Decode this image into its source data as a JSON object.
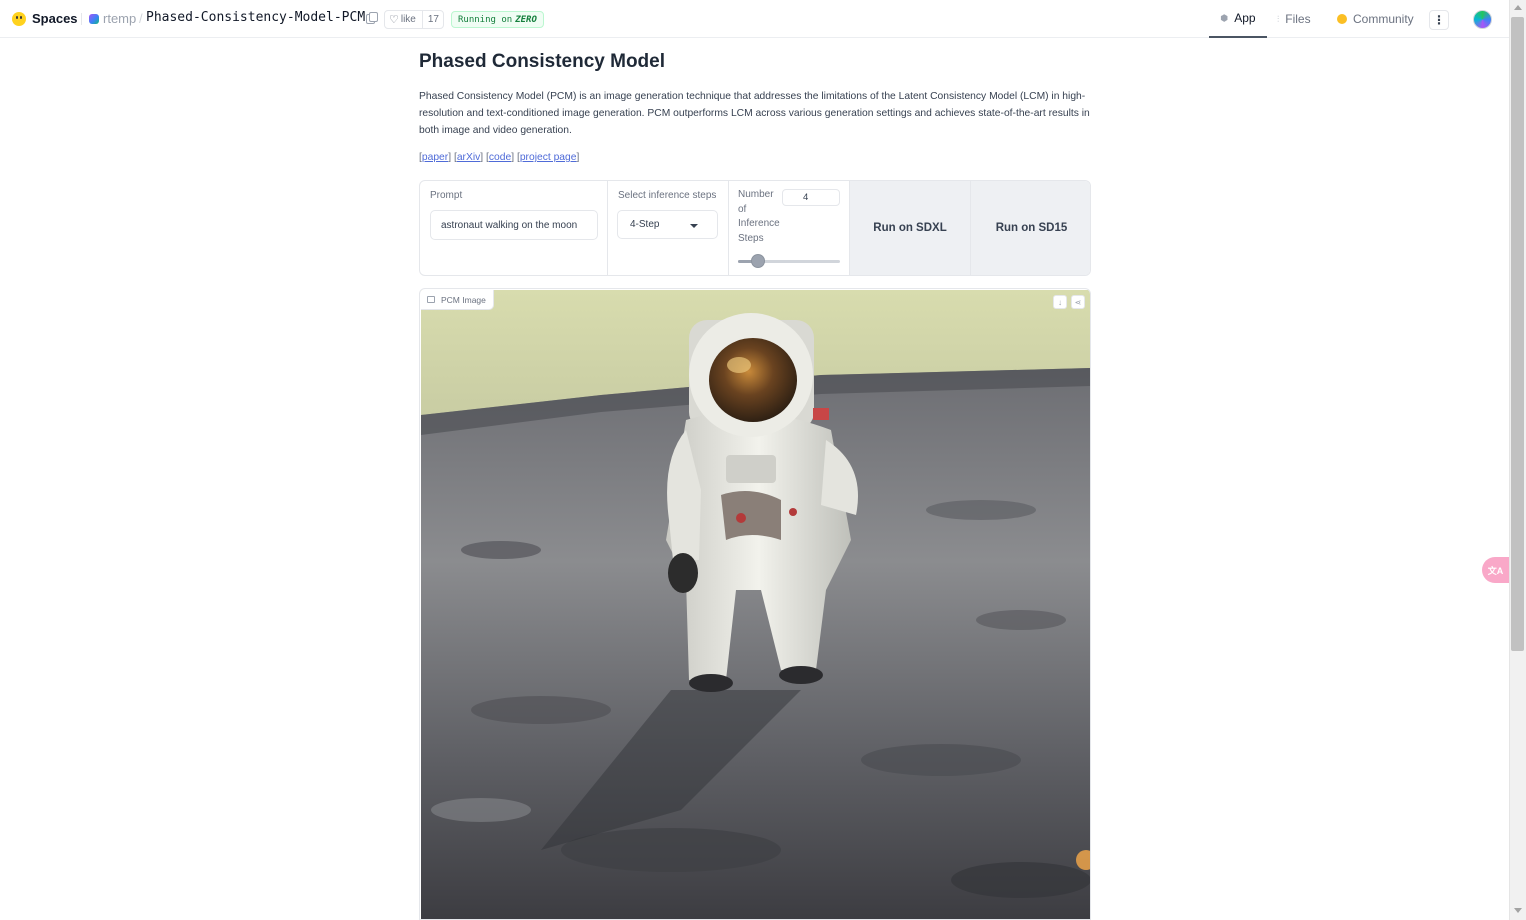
{
  "header": {
    "brand": "Spaces",
    "owner": "rtemp",
    "separator": "/",
    "repo": "Phased-Consistency-Model-PCM",
    "like_label": "like",
    "like_count": "17",
    "status_prefix": "Running on",
    "status_hardware": "ZERO",
    "nav": {
      "app": "App",
      "files": "Files",
      "community": "Community"
    },
    "more_label": "⋮"
  },
  "main": {
    "title": "Phased Consistency Model",
    "description": "Phased Consistency Model (PCM) is an image generation technique that addresses the limitations of the Latent Consistency Model (LCM) in high-resolution and text-conditioned image generation. PCM outperforms LCM across various generation settings and achieves state-of-the-art results in both image and video generation.",
    "links": {
      "paper": "paper",
      "arxiv": "arXiv",
      "code": "code",
      "project": "project page"
    },
    "controls": {
      "prompt_label": "Prompt",
      "prompt_value": "astronaut walking on the moon",
      "steps_select_label": "Select inference steps",
      "steps_select_value": "4-Step",
      "slider_label": "Number of Inference Steps",
      "slider_value": "4",
      "slider_fraction": 0.2,
      "run_sdxl": "Run on SDXL",
      "run_sd15": "Run on SD15"
    },
    "output": {
      "label": "PCM Image",
      "download_icon": "download-icon",
      "share_icon": "share-icon"
    }
  },
  "overlay": {
    "translate_label": "文A"
  },
  "colors": {
    "running_badge": "#15803d",
    "link": "#4f6bd8",
    "run_button_bg": "#eef0f3",
    "hf_logo": "#ffd21e"
  }
}
